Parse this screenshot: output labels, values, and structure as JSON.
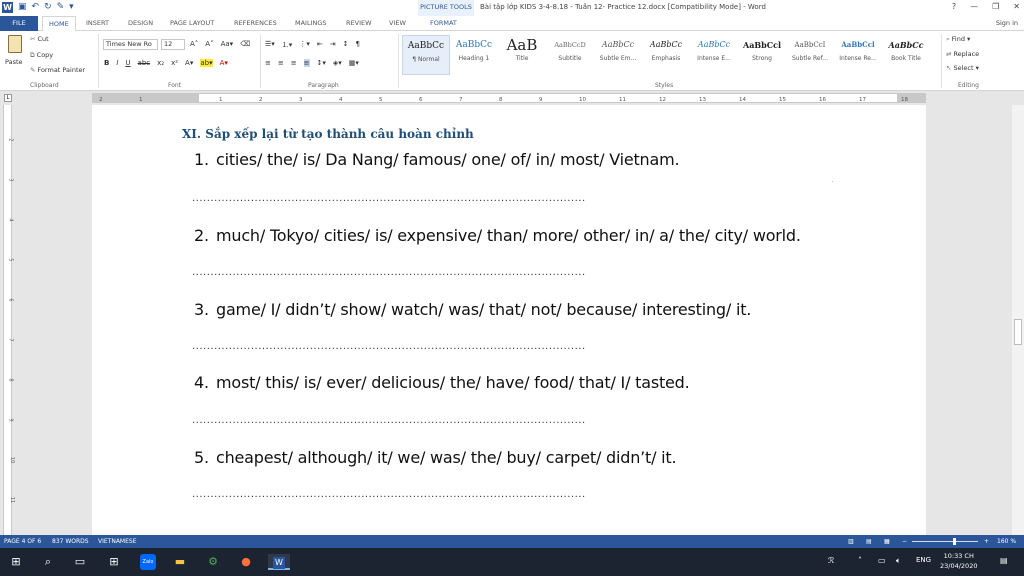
{
  "titlebar": {
    "context_tools": "PICTURE TOOLS",
    "document_title": "Bài tập lớp KIDS 3-4-8.18 - Tuần 12- Practice 12.docx [Compatibility Mode] - Word",
    "help": "?",
    "minimize": "—",
    "restore": "❐",
    "close": "✕"
  },
  "tabs": {
    "file": "FILE",
    "home": "HOME",
    "insert": "INSERT",
    "design": "DESIGN",
    "page_layout": "PAGE LAYOUT",
    "references": "REFERENCES",
    "mailings": "MAILINGS",
    "review": "REVIEW",
    "view": "VIEW",
    "format": "FORMAT",
    "sign_in": "Sign in"
  },
  "ribbon": {
    "clipboard": {
      "paste": "Paste",
      "cut": "Cut",
      "copy": "Copy",
      "format_painter": "Format Painter",
      "label": "Clipboard"
    },
    "font": {
      "name": "Times New Ro",
      "size": "12",
      "label": "Font"
    },
    "paragraph": {
      "label": "Paragraph"
    },
    "styles": {
      "label": "Styles",
      "items": [
        {
          "sample": "AaBbCc",
          "name": "¶ Normal"
        },
        {
          "sample": "AaBbCc",
          "name": "Heading 1"
        },
        {
          "sample": "AaB",
          "name": "Title"
        },
        {
          "sample": "AaBbCcD",
          "name": "Subtitle"
        },
        {
          "sample": "AaBbCc",
          "name": "Subtle Em..."
        },
        {
          "sample": "AaBbCc",
          "name": "Emphasis"
        },
        {
          "sample": "AaBbCc",
          "name": "Intense E..."
        },
        {
          "sample": "AaBbCcl",
          "name": "Strong"
        },
        {
          "sample": "AaBbCcI",
          "name": "Subtle Ref..."
        },
        {
          "sample": "AaBbCcl",
          "name": "Intense Re..."
        },
        {
          "sample": "AaBbCc",
          "name": "Book Title"
        }
      ]
    },
    "editing": {
      "find": "Find",
      "replace": "Replace",
      "select": "Select",
      "label": "Editing"
    }
  },
  "ruler": {
    "numbers": [
      "2",
      "1",
      "1",
      "2",
      "3",
      "4",
      "5",
      "6",
      "7",
      "8",
      "9",
      "10",
      "11",
      "12",
      "13",
      "14",
      "15",
      "16",
      "17",
      "18"
    ],
    "vertical_numbers": [
      "2",
      "3",
      "4",
      "5",
      "6",
      "7",
      "8",
      "9",
      "10",
      "11"
    ]
  },
  "document": {
    "heading": "XI. Sắp xếp lại từ tạo thành câu hoàn chỉnh",
    "questions": [
      {
        "num": "1.",
        "text": "cities/ the/ is/ Da Nang/ famous/ one/ of/ in/ most/ Vietnam."
      },
      {
        "num": "2.",
        "text": "much/ Tokyo/ cities/ is/ expensive/ than/ more/ other/ in/ a/ the/ city/ world."
      },
      {
        "num": "3.",
        "text": "game/ I/ didn’t/ show/ watch/ was/ that/ not/ because/ interesting/ it."
      },
      {
        "num": "4.",
        "text": "most/ this/ is/ ever/ delicious/ the/ have/ food/ that/ I/ tasted."
      },
      {
        "num": "5.",
        "text": "cheapest/ although/ it/ we/ was/ the/ buy/ carpet/ didn’t/ it."
      }
    ],
    "answer_line": "..........................................................................................................."
  },
  "statusbar": {
    "page": "PAGE 4 OF 6",
    "words": "837 WORDS",
    "language": "VIETNAMESE",
    "zoom": "160 %",
    "zoom_fraction": 0.62
  },
  "taskbar": {
    "language": "ENG",
    "time": "10:33 CH",
    "date": "23/04/2020",
    "zalo": "Zalo"
  },
  "colors": {
    "word_blue": "#2b579a",
    "heading_blue": "#1f4e79",
    "taskbar": "#1b2430"
  }
}
